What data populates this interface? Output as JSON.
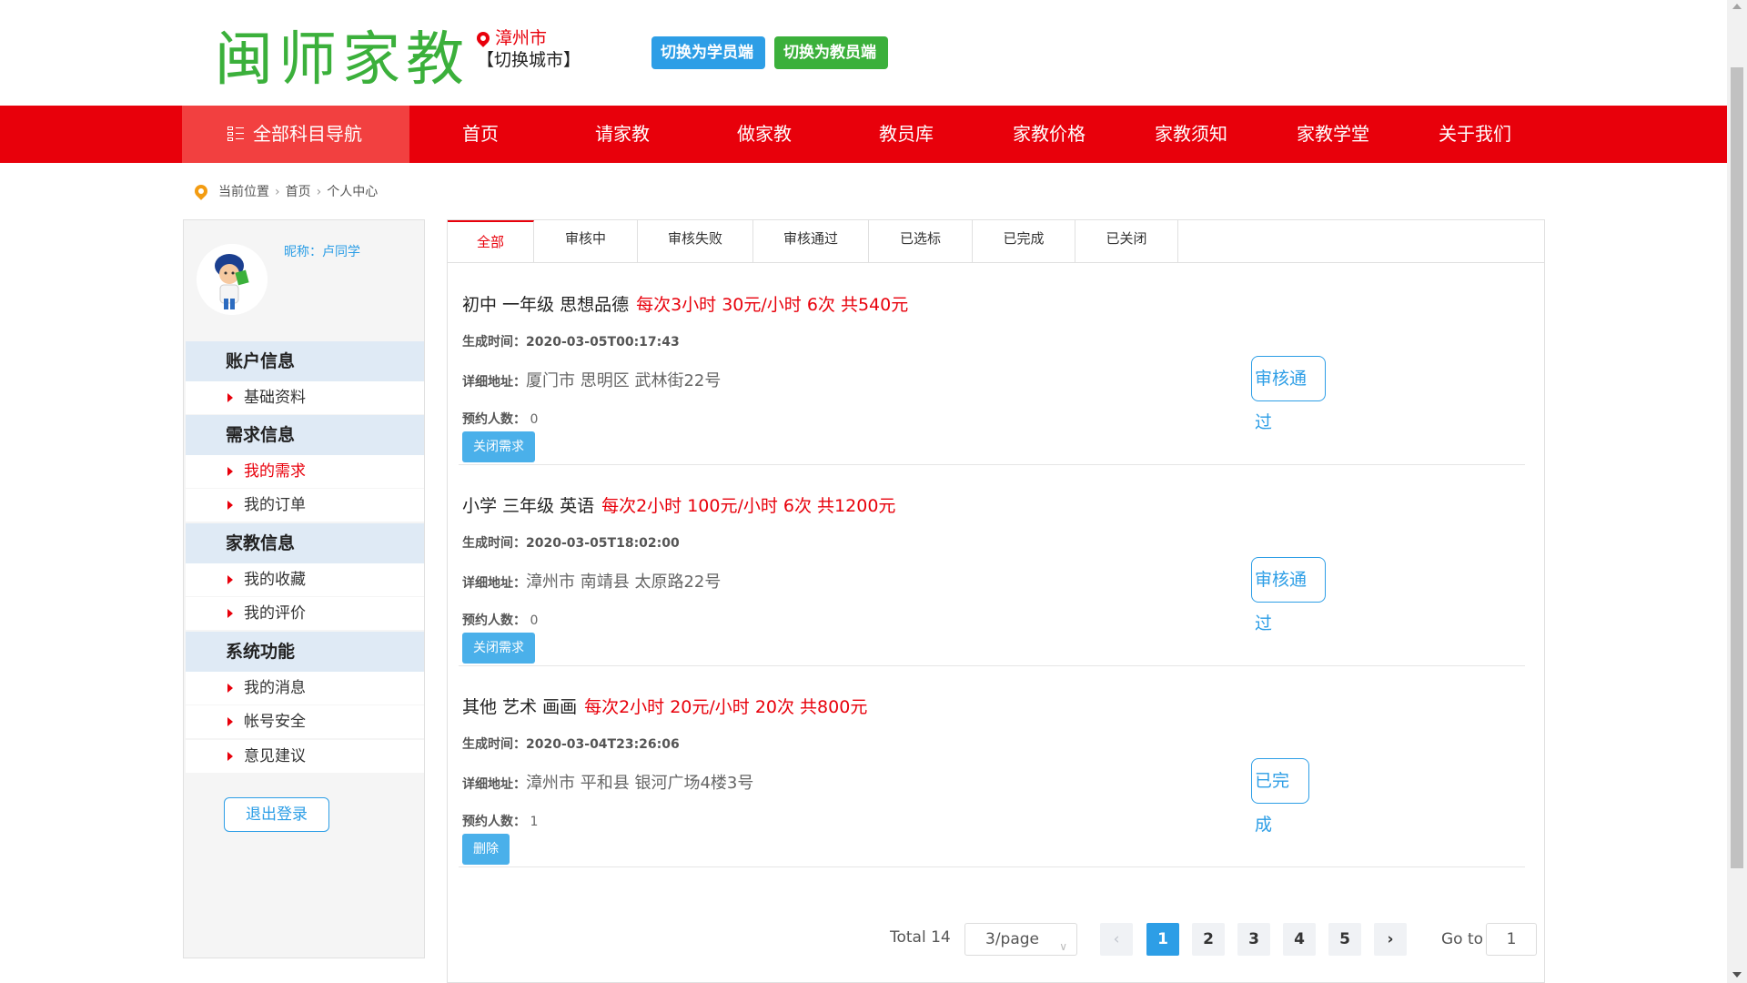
{
  "header": {
    "logo_text": "闽师家教",
    "city_name": "漳州市",
    "city_switch": "【切换城市】",
    "switch_student": "切换为学员端",
    "switch_teacher": "切换为教员端"
  },
  "nav": {
    "all_subjects": "全部科目导航",
    "items": [
      "首页",
      "请家教",
      "做家教",
      "教员库",
      "家教价格",
      "家教须知",
      "家教学堂",
      "关于我们"
    ]
  },
  "breadcrumb": {
    "label": "当前位置",
    "items": [
      "首页",
      "个人中心"
    ]
  },
  "sidebar": {
    "nickname": "昵称：卢同学",
    "sections": [
      {
        "title": "账户信息",
        "links": [
          "基础资料"
        ]
      },
      {
        "title": "需求信息",
        "links": [
          "我的需求",
          "我的订单"
        ]
      },
      {
        "title": "家教信息",
        "links": [
          "我的收藏",
          "我的评价"
        ]
      },
      {
        "title": "系统功能",
        "links": [
          "我的消息",
          "帐号安全",
          "意见建议"
        ]
      }
    ],
    "active_link": "我的需求",
    "logout": "退出登录"
  },
  "tabs": [
    "全部",
    "审核中",
    "审核失败",
    "审核通过",
    "已选标",
    "已完成",
    "已关闭"
  ],
  "active_tab": "全部",
  "labels": {
    "created": "生成时间：",
    "address": "详细地址：",
    "bookings": "预约人数："
  },
  "orders": [
    {
      "title": "初中 一年级 思想品德",
      "price": "每次3小时 30元/小时 6次 共540元",
      "created": "2020-03-05T00:17:43",
      "address": "厦门市 思明区 武林街22号",
      "bookings": "0",
      "action": "关闭需求",
      "status": "审核通过"
    },
    {
      "title": "小学 三年级 英语",
      "price": "每次2小时 100元/小时 6次 共1200元",
      "created": "2020-03-05T18:02:00",
      "address": "漳州市 南靖县 太原路22号",
      "bookings": "0",
      "action": "关闭需求",
      "status": "审核通过"
    },
    {
      "title": "其他 艺术 画画",
      "price": "每次2小时 20元/小时 20次 共800元",
      "created": "2020-03-04T23:26:06",
      "address": "漳州市 平和县 银河广场4楼3号",
      "bookings": "1",
      "action": "删除",
      "status": "已完成"
    }
  ],
  "pagination": {
    "total": "Total 14",
    "page_size": "3/page",
    "pages": [
      "1",
      "2",
      "3",
      "4",
      "5"
    ],
    "current": "1",
    "goto_label": "Go to",
    "goto_value": "1"
  },
  "colors": {
    "brand_red": "#e8000b",
    "brand_green": "#3bb03b",
    "accent_blue": "#2d9ee6"
  }
}
